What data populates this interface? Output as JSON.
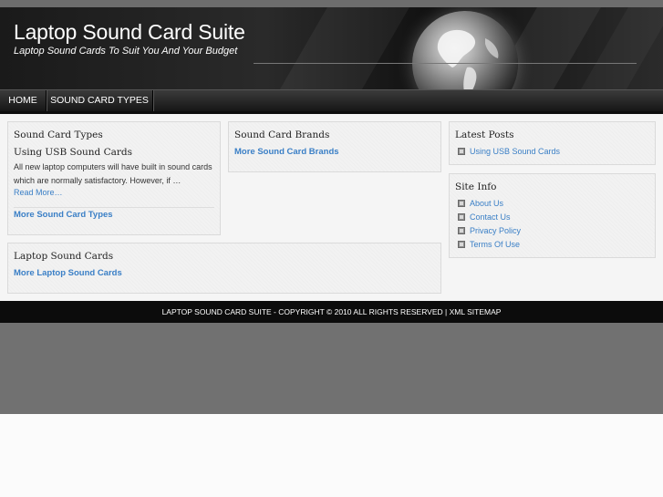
{
  "header": {
    "title": "Laptop Sound Card Suite",
    "tagline": "Laptop Sound Cards To Suit You And Your Budget"
  },
  "nav": {
    "items": [
      {
        "label": "HOME"
      },
      {
        "label": "SOUND CARD TYPES"
      }
    ]
  },
  "sound_card_types": {
    "heading": "Sound Card Types",
    "post_title": "Using USB Sound Cards",
    "excerpt": "All new laptop computers will have built in sound cards which are normally satisfactory. However, if …",
    "read_more": "Read More…",
    "more_link": "More Sound Card Types"
  },
  "sound_card_brands": {
    "heading": "Sound Card Brands",
    "more_link": "More Sound Card Brands"
  },
  "laptop_sound_cards": {
    "heading": "Laptop Sound Cards",
    "more_link": "More Laptop Sound Cards"
  },
  "latest_posts": {
    "heading": "Latest Posts",
    "items": [
      "Using USB Sound Cards"
    ]
  },
  "site_info": {
    "heading": "Site Info",
    "items": [
      "About Us",
      "Contact Us",
      "Privacy Policy",
      "Terms Of Use"
    ]
  },
  "footer": {
    "text": "LAPTOP SOUND CARD SUITE - COPYRIGHT © 2010 ALL RIGHTS RESERVED | XML SITEMAP"
  },
  "colors": {
    "link": "#3a7fc6",
    "footer_bg": "#0c0c0c",
    "header_bg": "#1a1a1a"
  }
}
